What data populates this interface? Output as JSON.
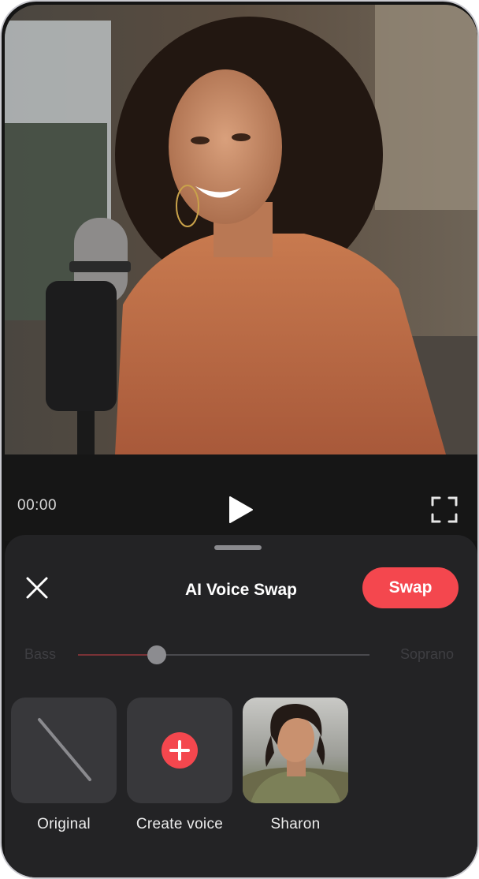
{
  "player": {
    "time": "00:00"
  },
  "sheet": {
    "title": "AI Voice Swap",
    "swap_label": "Swap",
    "slider": {
      "min_label": "Bass",
      "max_label": "Soprano",
      "value_fraction": 0.27
    },
    "voices": [
      {
        "label": "Original",
        "icon": "none-slash-icon"
      },
      {
        "label": "Create voice",
        "icon": "plus-icon"
      },
      {
        "label": "Sharon",
        "icon": "avatar"
      }
    ]
  },
  "colors": {
    "accent": "#f4474e",
    "sheet_bg": "#232325",
    "tile_bg": "#38383b"
  }
}
